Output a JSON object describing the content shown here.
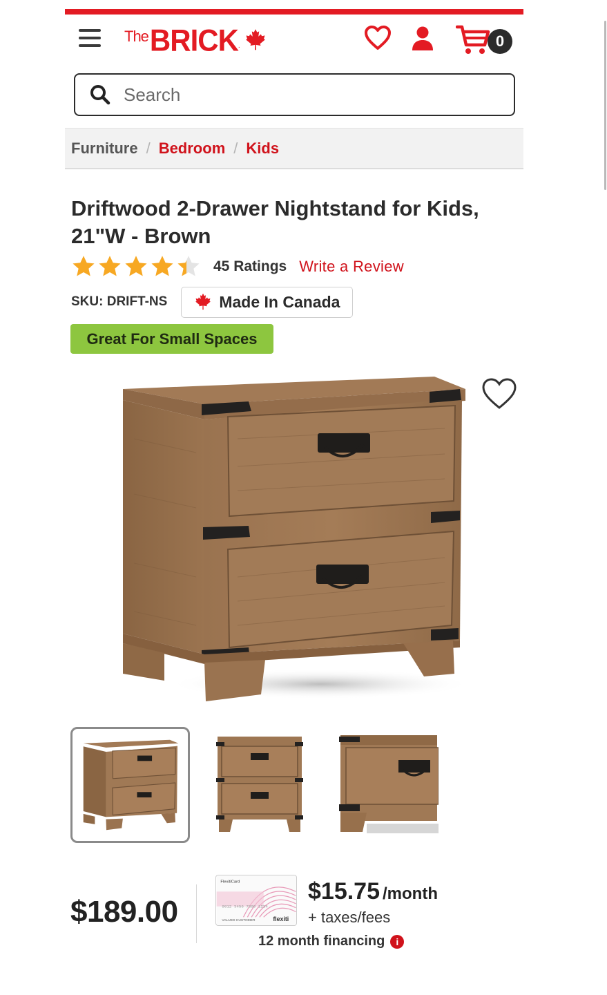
{
  "header": {
    "logo_prefix": "The",
    "logo_name": "BRICK",
    "logo_dot": ".",
    "cart_count": "0",
    "brand_color": "#e31b23"
  },
  "search": {
    "placeholder": "Search"
  },
  "breadcrumb": {
    "items": [
      "Furniture",
      "Bedroom",
      "Kids"
    ],
    "separator": "/"
  },
  "product": {
    "title": "Driftwood 2-Drawer Nightstand for Kids, 21\"W - Brown",
    "rating": 4.4,
    "rating_max": 5,
    "ratings_count": "45 Ratings",
    "write_review": "Write a Review",
    "sku": "SKU: DRIFT-NS",
    "made_in": "Made In Canada",
    "badge": "Great For Small Spaces",
    "badge_color": "#8dc63f"
  },
  "gallery": {
    "selected_index": 0,
    "thumbnail_count": 3
  },
  "pricing": {
    "price": "$189.00",
    "monthly": "$15.75",
    "monthly_unit": "/month",
    "taxes": "+ taxes/fees",
    "financing": "12 month financing",
    "info_icon": "i"
  },
  "icons": [
    "hamburger-icon",
    "maple-leaf-icon",
    "heart-icon",
    "account-icon",
    "cart-icon",
    "search-icon",
    "star-icon",
    "info-icon"
  ]
}
